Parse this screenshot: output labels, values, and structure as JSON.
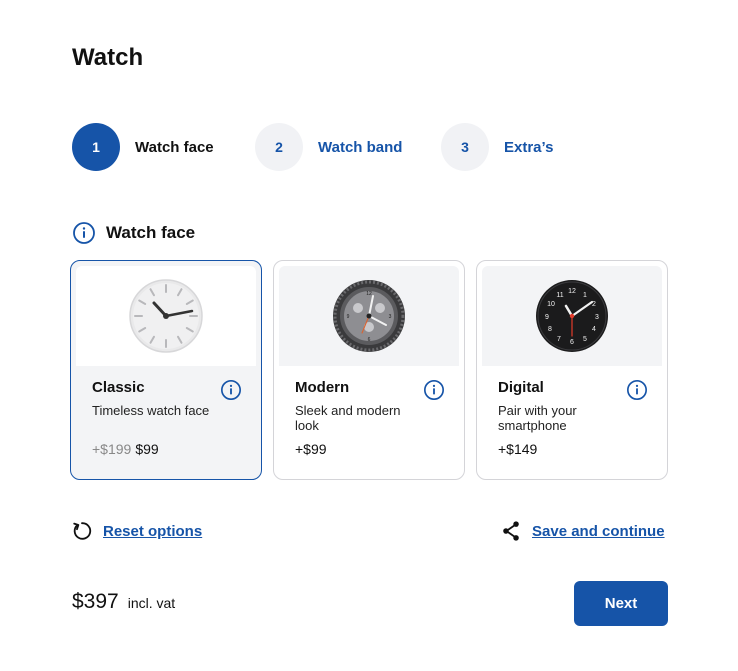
{
  "page": {
    "title": "Watch"
  },
  "steps": [
    {
      "number": "1",
      "label": "Watch face",
      "state": "active"
    },
    {
      "number": "2",
      "label": "Watch band",
      "state": "idle"
    },
    {
      "number": "3",
      "label": "Extra’s",
      "state": "idle"
    }
  ],
  "section": {
    "title": "Watch face",
    "icon": "info-icon"
  },
  "options": [
    {
      "name": "Classic",
      "description": "Timeless watch face",
      "old_price": "+$199",
      "price": "$99",
      "selected": true,
      "icon": "classic-watch-face-image"
    },
    {
      "name": "Modern",
      "description": "Sleek and modern look",
      "price": "+$99",
      "selected": false,
      "icon": "modern-watch-face-image"
    },
    {
      "name": "Digital",
      "description": "Pair with your smartphone",
      "price": "+$149",
      "selected": false,
      "icon": "digital-watch-face-image"
    }
  ],
  "actions": {
    "reset_label": "Reset options",
    "save_label": "Save and continue"
  },
  "footer": {
    "total": "$397",
    "vat_label": "incl. vat",
    "next_label": "Next"
  },
  "colors": {
    "accent": "#1654a8",
    "selected_bg": "#f3f4f6",
    "border": "#d4d4d8"
  }
}
